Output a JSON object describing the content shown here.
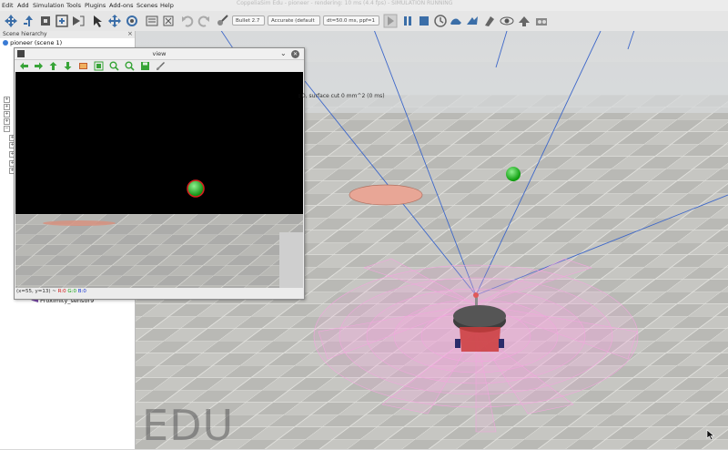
{
  "window": {
    "title_text": "CoppeliaSim Edu - pioneer - rendering: 10 ms (4.4 fps) - SIMULATION RUNNING"
  },
  "menu": [
    "Edit",
    "Add",
    "Simulation",
    "Tools",
    "Plugins",
    "Add-ons",
    "Scenes",
    "Help"
  ],
  "toolbar": {
    "engine": "Bullet 2.7",
    "accuracy": "Accurate (default",
    "timestep": "dt=50.0 ms, ppf=1"
  },
  "hierarchy": {
    "title": "Scene hierarchy",
    "close": "×",
    "root": "pioneer (scene 1)",
    "visible_item": "Proximity_sensor9"
  },
  "view": {
    "title": "view",
    "status": "(x=55, y=13) ~ R:0 G:0 B:0",
    "status_parts": {
      "coords": "(x=55, y=13) ~ ",
      "r": "R:0",
      "g": "G:0",
      "b": "B:0"
    }
  },
  "info_text": ": 0, surface cut 0 mm^2 (0 ms)",
  "watermark": "EDU",
  "colors": {
    "floor": "#c2c2be",
    "sky": "#e0e0e0",
    "sphere": "#19c519",
    "target_disc": "#e9a79a",
    "sensor_cones": "#f2a6de",
    "robot_body": "#4a4a4a"
  },
  "icons": {
    "view_toolbar": [
      "arrow-left-icon",
      "arrow-right-icon",
      "arrow-up-icon",
      "arrow-down-icon",
      "image-icon",
      "fit-icon",
      "zoom-in-icon",
      "zoom-out-icon",
      "save-icon",
      "brush-icon"
    ]
  }
}
